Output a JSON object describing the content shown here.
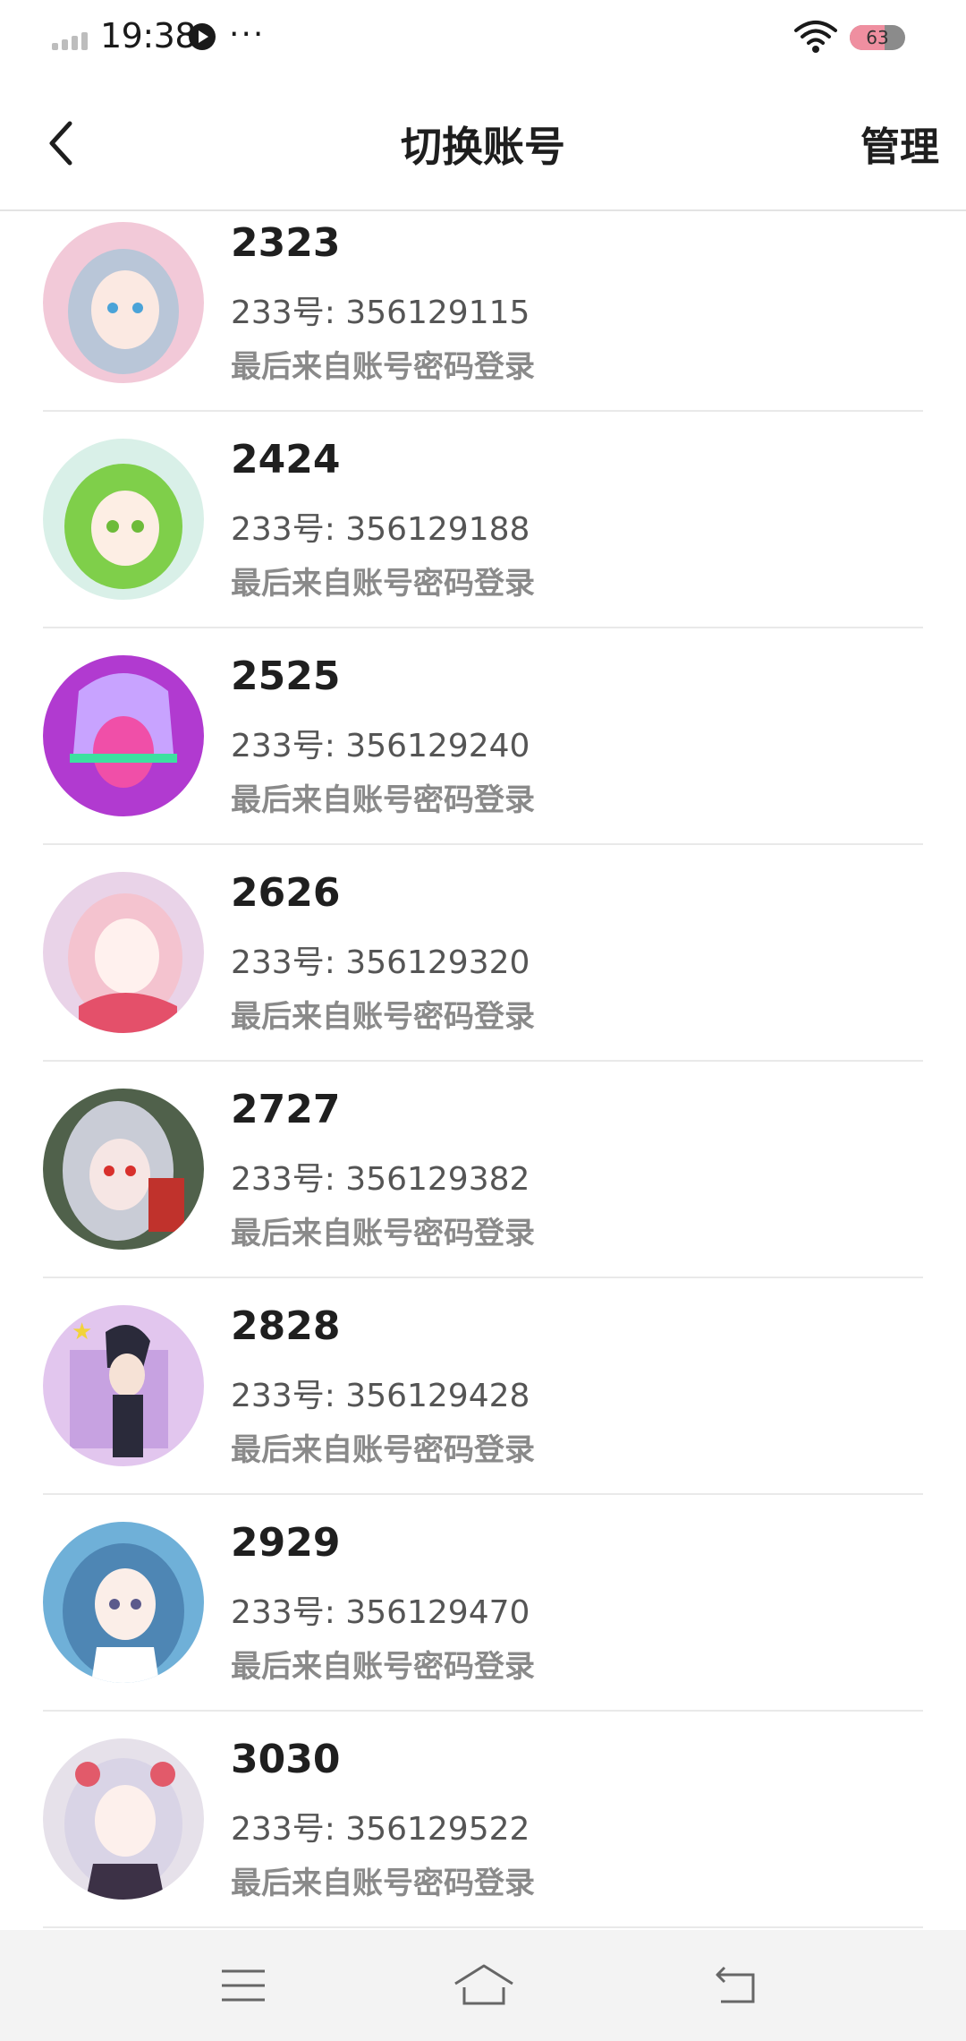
{
  "status_bar": {
    "time": "19:38",
    "more": "···",
    "battery_level": "63",
    "battery_fraction": 0.63,
    "icons": [
      "signal-icon",
      "play-icon",
      "wifi-icon",
      "battery-icon"
    ]
  },
  "nav": {
    "title": "切换账号",
    "manage_label": "管理",
    "back_icon": "chevron-left-icon"
  },
  "accounts": [
    {
      "name": "2323",
      "id_text": "233号: 356129115",
      "login_text": "最后来自账号密码登录",
      "avatar_bg": "#f2c9d8",
      "avatar_hair": "#b9c6d8"
    },
    {
      "name": "2424",
      "id_text": "233号: 356129188",
      "login_text": "最后来自账号密码登录",
      "avatar_bg": "#d9f0e8",
      "avatar_hair": "#7fcf4a"
    },
    {
      "name": "2525",
      "id_text": "233号: 356129240",
      "login_text": "最后来自账号密码登录",
      "avatar_bg": "#b13ad0",
      "avatar_hair": "#c8a3ff"
    },
    {
      "name": "2626",
      "id_text": "233号: 356129320",
      "login_text": "最后来自账号密码登录",
      "avatar_bg": "#e9d3e8",
      "avatar_hair": "#f4c3cf"
    },
    {
      "name": "2727",
      "id_text": "233号: 356129382",
      "login_text": "最后来自账号密码登录",
      "avatar_bg": "#50614b",
      "avatar_hair": "#c9ccd6"
    },
    {
      "name": "2828",
      "id_text": "233号: 356129428",
      "login_text": "最后来自账号密码登录",
      "avatar_bg": "#e2c6ee",
      "avatar_hair": "#2a2a3a"
    },
    {
      "name": "2929",
      "id_text": "233号: 356129470",
      "login_text": "最后来自账号密码登录",
      "avatar_bg": "#6fb0d8",
      "avatar_hair": "#6aa4c9"
    },
    {
      "name": "3030",
      "id_text": "233号: 356129522",
      "login_text": "最后来自账号密码登录",
      "avatar_bg": "#e6e1ea",
      "avatar_hair": "#d9d4e6"
    }
  ],
  "system_nav": {
    "icons": [
      "menu-icon",
      "home-icon",
      "back-icon"
    ]
  }
}
